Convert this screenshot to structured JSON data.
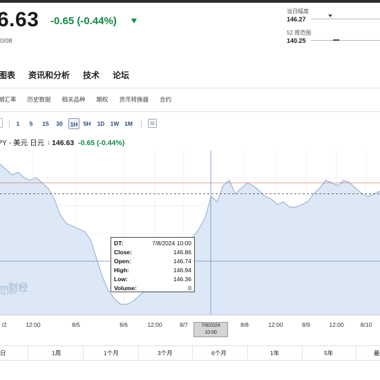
{
  "header": {
    "price": "6.63",
    "change": "-0.65 (-0.44%)",
    "date": "0/08"
  },
  "stats": {
    "day_range_label": "当日幅度",
    "day_range_value": "146.27",
    "week52_label": "52 周范围",
    "week52_value": "140.25"
  },
  "nav": [
    "图表",
    "资讯和分析",
    "技术",
    "论坛"
  ],
  "subnav": [
    "期汇率",
    "历史数据",
    "相关品种",
    "期权",
    "货币转换器",
    "合约"
  ],
  "toolbar": {
    "intervals": [
      "1",
      "5",
      "15",
      "30",
      "1H",
      "5H",
      "1D",
      "1W",
      "1M"
    ],
    "active": "1H"
  },
  "chart_title": {
    "symbol": "PY - 美元 日元",
    "price": "146.63",
    "change": "-0.65 (-0.44%)"
  },
  "tooltip": {
    "dt_label": "DT:",
    "dt": "7/8/2024 10:00",
    "close_label": "Close:",
    "close": "146.86",
    "open_label": "Open:",
    "open": "146.74",
    "high_label": "High:",
    "high": "146.94",
    "low_label": "Low:",
    "low": "146.36",
    "volume_label": "Volume:",
    "volume": "0"
  },
  "x_labels": [
    "/2",
    "12:00",
    "8/5",
    "8/6",
    "12:00",
    "8/7",
    "8/8",
    "12:00",
    "8/9",
    "12:00",
    "8/10"
  ],
  "x_cursor": {
    "date": "7/8/2024",
    "time": "10:00"
  },
  "watermark": "m财经",
  "watermark_sub": "ng.com",
  "periods": [
    "日",
    "1周",
    "1个月",
    "3个月",
    "6个月",
    "1年",
    "5年",
    "最"
  ],
  "colors": {
    "green": "#0e8a43",
    "line": "#9ab6d6",
    "fill": "#dce8f5",
    "red_line": "#e06060"
  },
  "chart_data": {
    "type": "area",
    "series": [
      {
        "values": [
          147.5,
          147.3,
          147.1,
          147.2,
          147.0,
          146.9,
          147.0,
          146.8,
          146.6,
          146.2,
          145.6,
          145.3,
          145.2,
          145.1,
          145.0,
          144.7,
          144.0,
          143.3,
          142.8,
          142.5,
          142.3,
          142.3,
          142.4,
          142.6,
          142.8,
          143.3,
          143.7,
          144.2,
          144.4,
          144.4,
          144.3,
          144.4,
          144.8,
          145.1,
          145.5,
          146.3,
          146.1,
          146.7,
          146.9,
          146.4,
          146.6,
          146.8,
          146.7,
          146.5,
          146.3,
          146.2,
          146.0,
          146.1,
          145.9,
          145.9,
          146.0,
          146.1,
          146.4,
          146.6,
          146.9,
          146.8,
          146.7,
          146.9,
          146.8,
          146.6,
          146.4,
          146.3,
          146.4,
          146.5
        ]
      }
    ],
    "reference_lines": [
      146.4,
      146.8
    ],
    "grid": true
  }
}
